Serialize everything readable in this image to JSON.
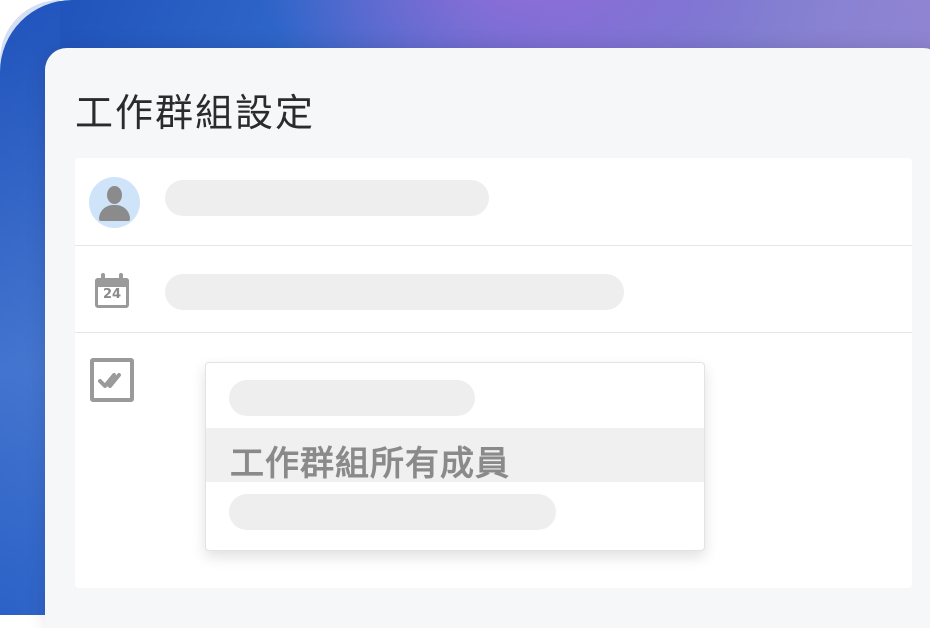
{
  "page": {
    "title": "工作群組設定"
  },
  "rows": [
    {
      "icon": "user-avatar-icon"
    },
    {
      "icon": "calendar-icon",
      "calendar_day": "24"
    },
    {
      "icon": "task-check-icon"
    }
  ],
  "dropdown": {
    "selected_option": "工作群組所有成員"
  },
  "colors": {
    "background_gradient_start": "#1d4fb8",
    "background_gradient_end": "#9a92cf",
    "card_bg": "#f6f7f9",
    "panel_bg": "#ffffff",
    "placeholder_pill": "#eeeeee",
    "icon_gray": "#9a9a9a",
    "avatar_bg": "#cfe3f9"
  }
}
